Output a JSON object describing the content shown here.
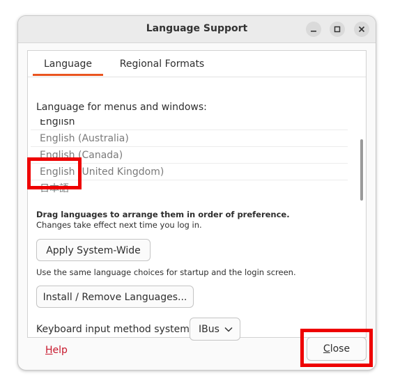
{
  "window": {
    "title": "Language Support"
  },
  "tabs": [
    {
      "label": "Language",
      "active": true
    },
    {
      "label": "Regional Formats",
      "active": false
    }
  ],
  "language_section": {
    "heading": "Language for menus and windows:",
    "languages": [
      "English",
      "English (Australia)",
      "English (Canada)",
      "English (United Kingdom)",
      "日本語"
    ],
    "drag_hint_bold": "Drag languages to arrange them in order of preference.",
    "drag_hint_note": "Changes take effect next time you log in.",
    "apply_button": "Apply System-Wide",
    "apply_note": "Use the same language choices for startup and the login screen.",
    "install_button": "Install / Remove Languages...",
    "keyboard_label": "Keyboard input method system:",
    "keyboard_value": "IBus"
  },
  "footer": {
    "help_first": "H",
    "help_rest": "elp",
    "close_first": "C",
    "close_rest": "lose"
  },
  "colors": {
    "accent": "#e95420",
    "help_link": "#c7162b",
    "highlight": "#ee0000"
  }
}
